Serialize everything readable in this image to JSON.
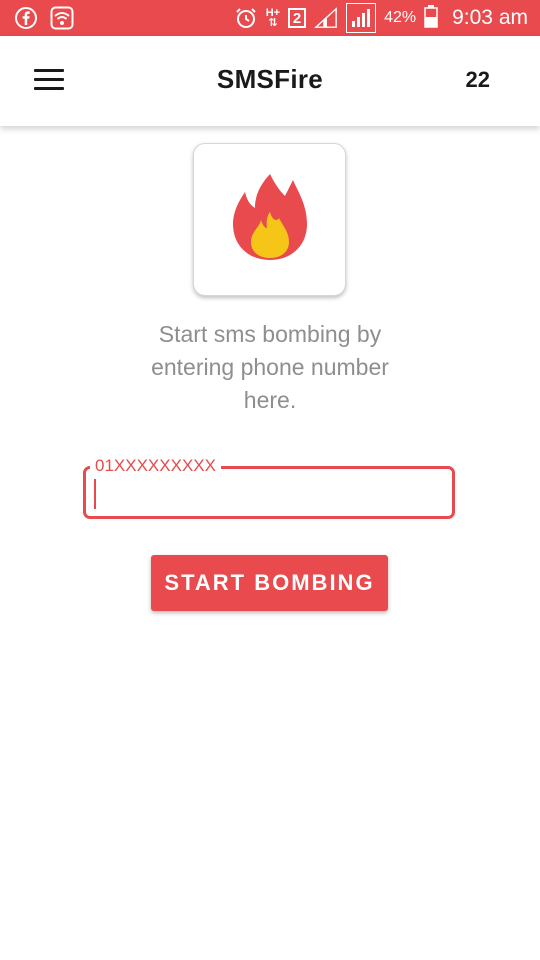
{
  "colors": {
    "accent": "#e84a4d",
    "flame_outer": "#e84a4d",
    "flame_inner": "#f5c518",
    "tagline": "#8e8e8e"
  },
  "status_bar": {
    "left_icons": [
      "facebook-icon",
      "wifi-icon"
    ],
    "network": "H+",
    "sim_slot": "2",
    "battery": "42%",
    "time": "9:03 am"
  },
  "app_bar": {
    "menu_icon": "hamburger-menu-icon",
    "title": "SMSFire",
    "counter": "22"
  },
  "main": {
    "logo_icon": "fire-icon",
    "tagline_lines": [
      "Start sms bombing by",
      "entering phone number",
      "here."
    ],
    "phone_input": {
      "label": "01XXXXXXXXX",
      "value": ""
    },
    "start_button": "START BOMBING"
  }
}
